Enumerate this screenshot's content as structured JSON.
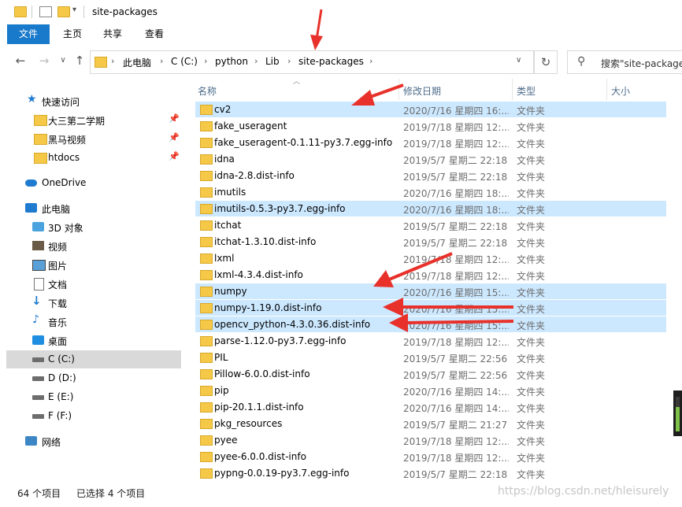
{
  "window": {
    "title": "site-packages"
  },
  "ribbon": {
    "tabs": [
      "文件",
      "主页",
      "共享",
      "查看"
    ]
  },
  "address": {
    "crumbs": [
      "此电脑",
      "C (C:)",
      "python",
      "Lib",
      "site-packages"
    ],
    "search_placeholder": "搜索\"site-packages\""
  },
  "sidebar": {
    "items": [
      {
        "label": "快速访问",
        "icon": "star-icon",
        "kind": "section"
      },
      {
        "label": "大三第二学期",
        "icon": "folder-icon",
        "pinned": true
      },
      {
        "label": "黑马视频",
        "icon": "folder-icon",
        "pinned": true
      },
      {
        "label": "htdocs",
        "icon": "folder-icon",
        "pinned": true
      },
      {
        "label": "OneDrive",
        "icon": "cloud-icon",
        "kind": "section"
      },
      {
        "label": "此电脑",
        "icon": "computer-icon",
        "kind": "section"
      },
      {
        "label": "3D 对象",
        "icon": "cube-icon"
      },
      {
        "label": "视频",
        "icon": "video-icon"
      },
      {
        "label": "图片",
        "icon": "picture-icon"
      },
      {
        "label": "文档",
        "icon": "document-icon"
      },
      {
        "label": "下载",
        "icon": "download-icon"
      },
      {
        "label": "音乐",
        "icon": "music-icon"
      },
      {
        "label": "桌面",
        "icon": "desktop-icon"
      },
      {
        "label": "C (C:)",
        "icon": "drive-icon",
        "selected": true
      },
      {
        "label": "D (D:)",
        "icon": "drive-icon"
      },
      {
        "label": "E (E:)",
        "icon": "drive-icon"
      },
      {
        "label": "F (F:)",
        "icon": "drive-icon"
      },
      {
        "label": "网络",
        "icon": "network-icon",
        "kind": "section"
      }
    ]
  },
  "columns": {
    "name": "名称",
    "date": "修改日期",
    "type": "类型",
    "size": "大小"
  },
  "files": [
    {
      "name": "cv2",
      "date": "2020/7/16 星期四 16:...",
      "type": "文件夹",
      "selected": true
    },
    {
      "name": "fake_useragent",
      "date": "2019/7/18 星期四 12:...",
      "type": "文件夹"
    },
    {
      "name": "fake_useragent-0.1.11-py3.7.egg-info",
      "date": "2019/7/18 星期四 12:...",
      "type": "文件夹"
    },
    {
      "name": "idna",
      "date": "2019/5/7 星期二 22:18",
      "type": "文件夹"
    },
    {
      "name": "idna-2.8.dist-info",
      "date": "2019/5/7 星期二 22:18",
      "type": "文件夹"
    },
    {
      "name": "imutils",
      "date": "2020/7/16 星期四 18:...",
      "type": "文件夹"
    },
    {
      "name": "imutils-0.5.3-py3.7.egg-info",
      "date": "2020/7/16 星期四 18:...",
      "type": "文件夹",
      "selected": true
    },
    {
      "name": "itchat",
      "date": "2019/5/7 星期二 22:18",
      "type": "文件夹"
    },
    {
      "name": "itchat-1.3.10.dist-info",
      "date": "2019/5/7 星期二 22:18",
      "type": "文件夹"
    },
    {
      "name": "lxml",
      "date": "2019/7/18 星期四 12:...",
      "type": "文件夹"
    },
    {
      "name": "lxml-4.3.4.dist-info",
      "date": "2019/7/18 星期四 12:...",
      "type": "文件夹"
    },
    {
      "name": "numpy",
      "date": "2020/7/16 星期四 15:...",
      "type": "文件夹",
      "selected": true
    },
    {
      "name": "numpy-1.19.0.dist-info",
      "date": "2020/7/16 星期四 15:...",
      "type": "文件夹",
      "selected": true
    },
    {
      "name": "opencv_python-4.3.0.36.dist-info",
      "date": "2020/7/16 星期四 15:...",
      "type": "文件夹",
      "selected": true
    },
    {
      "name": "parse-1.12.0-py3.7.egg-info",
      "date": "2019/7/18 星期四 12:...",
      "type": "文件夹"
    },
    {
      "name": "PIL",
      "date": "2019/5/7 星期二 22:56",
      "type": "文件夹"
    },
    {
      "name": "Pillow-6.0.0.dist-info",
      "date": "2019/5/7 星期二 22:56",
      "type": "文件夹"
    },
    {
      "name": "pip",
      "date": "2020/7/16 星期四 14:...",
      "type": "文件夹"
    },
    {
      "name": "pip-20.1.1.dist-info",
      "date": "2020/7/16 星期四 14:...",
      "type": "文件夹"
    },
    {
      "name": "pkg_resources",
      "date": "2019/5/7 星期二 21:27",
      "type": "文件夹"
    },
    {
      "name": "pyee",
      "date": "2019/7/18 星期四 12:...",
      "type": "文件夹"
    },
    {
      "name": "pyee-6.0.0.dist-info",
      "date": "2019/7/18 星期四 12:...",
      "type": "文件夹"
    },
    {
      "name": "pypng-0.0.19-py3.7.egg-info",
      "date": "2019/5/7 星期二 22:18",
      "type": "文件夹"
    }
  ],
  "status": {
    "count": "64 个项目",
    "selection": "已选择 4 个项目"
  },
  "watermark": "https://blog.csdn.net/hleisurely",
  "colors": {
    "selection": "#cce8ff",
    "file_tab": "#1979ca",
    "annotation_arrow": "#e8312a",
    "folder": "#f6c847"
  }
}
